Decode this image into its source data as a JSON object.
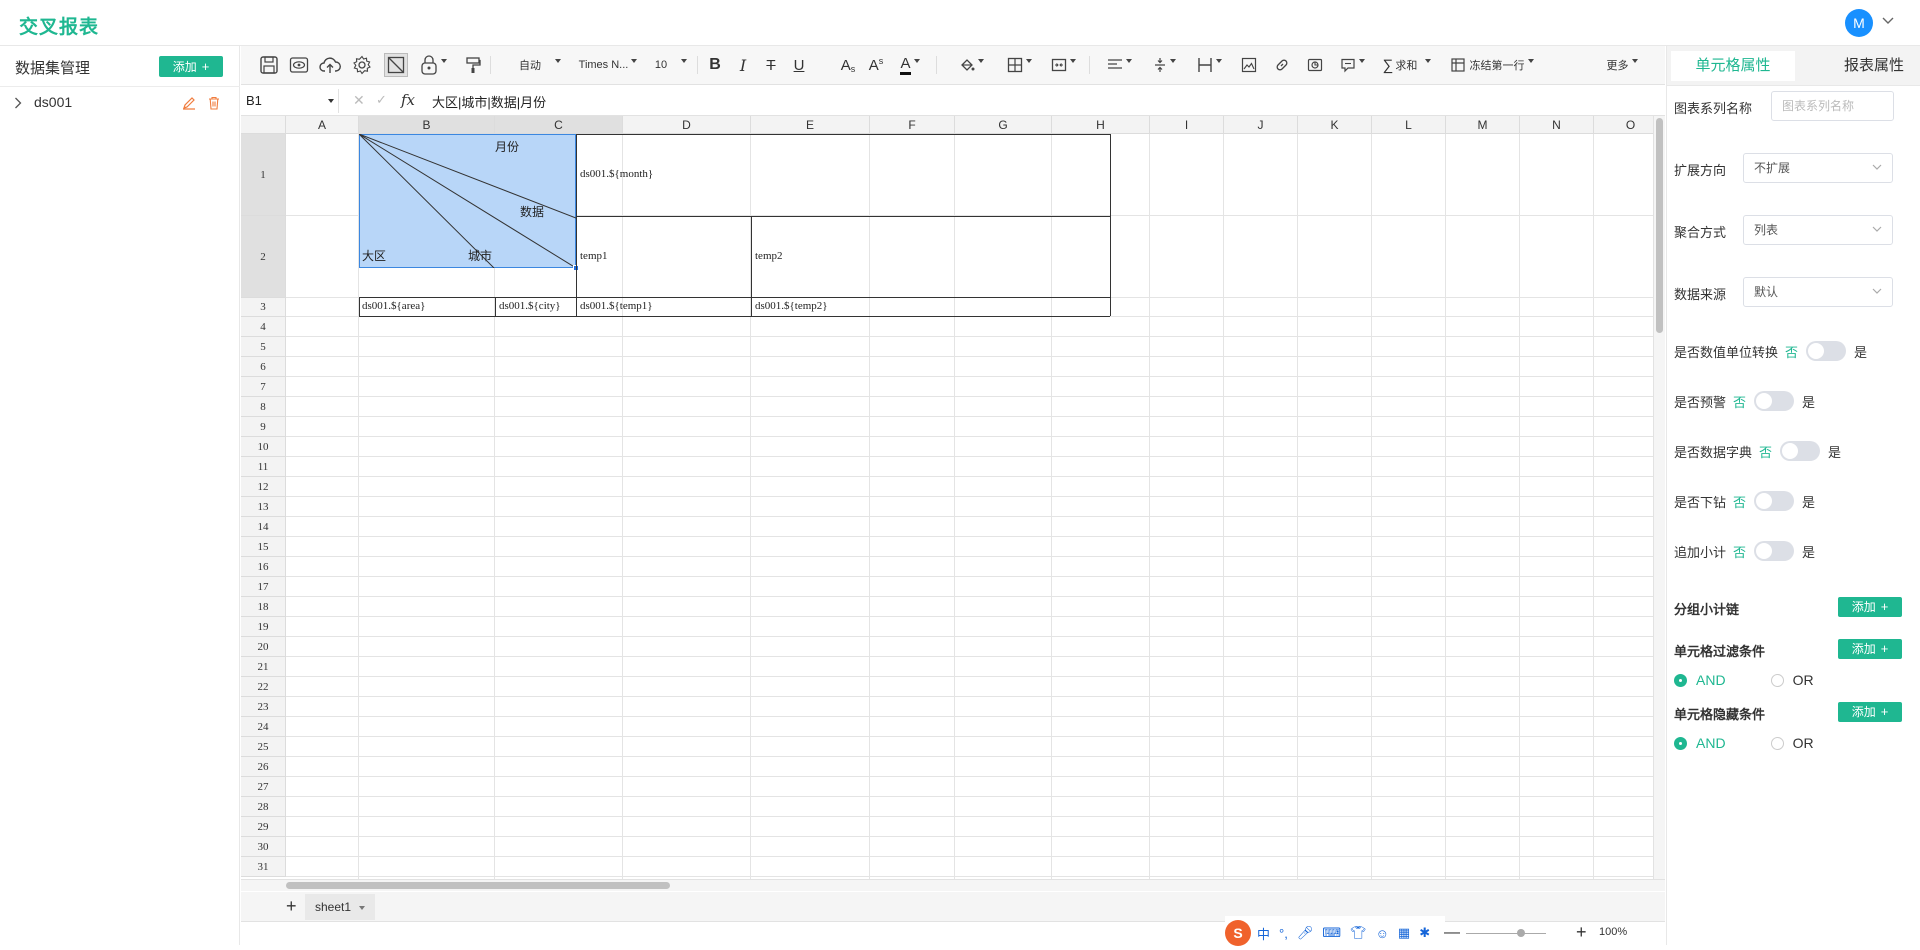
{
  "app": {
    "title": "交叉报表",
    "avatar_letter": "M"
  },
  "left_panel": {
    "title": "数据集管理",
    "add_label": "添加",
    "datasets": [
      {
        "name": "ds001"
      }
    ]
  },
  "toolbar": {
    "font_size_mode": "自动",
    "font_family": "Times N...",
    "font_size": "10",
    "sum_label": "求和",
    "freeze_label": "冻结第一行",
    "more_label": "更多"
  },
  "formula_bar": {
    "cell_ref": "B1",
    "fx": "fx",
    "formula": "大区|城市|数据|月份"
  },
  "grid": {
    "columns": [
      "A",
      "B",
      "C",
      "D",
      "E",
      "F",
      "G",
      "H",
      "I",
      "J",
      "K",
      "L",
      "M",
      "N",
      "O"
    ],
    "rows": [
      "1",
      "2",
      "3",
      "4",
      "5",
      "6",
      "7",
      "8",
      "9",
      "10",
      "11",
      "12",
      "13",
      "14",
      "15",
      "16",
      "17",
      "18",
      "19",
      "20",
      "21",
      "22",
      "23",
      "24",
      "25",
      "26",
      "27",
      "28",
      "29",
      "30",
      "31"
    ],
    "diagonal_labels": {
      "month": "月份",
      "data": "数据",
      "area": "大区",
      "city": "城市"
    },
    "cells": {
      "D1": "ds001.${month}",
      "D2": "temp1",
      "E2": "temp2",
      "B3": "ds001.${area}",
      "C3": "ds001.${city}",
      "D3": "ds001.${temp1}",
      "E3": "ds001.${temp2}"
    }
  },
  "sheet": {
    "name": "sheet1",
    "add": "+"
  },
  "zoom": {
    "value": "100%",
    "minus": "—",
    "plus": "+"
  },
  "ime": {
    "lang": "中",
    "punct": "°,"
  },
  "right_panel": {
    "tabs": [
      "单元格属性",
      "报表属性"
    ],
    "series_name_label": "图表系列名称",
    "series_name_placeholder": "图表系列名称",
    "expand_label": "扩展方向",
    "expand_value": "不扩展",
    "aggregate_label": "聚合方式",
    "aggregate_value": "列表",
    "source_label": "数据来源",
    "source_value": "默认",
    "toggles": [
      {
        "label": "是否数值单位转换",
        "no": "否",
        "yes": "是"
      },
      {
        "label": "是否预警",
        "no": "否",
        "yes": "是"
      },
      {
        "label": "是否数据字典",
        "no": "否",
        "yes": "是"
      },
      {
        "label": "是否下钻",
        "no": "否",
        "yes": "是"
      },
      {
        "label": "追加小计",
        "no": "否",
        "yes": "是"
      }
    ],
    "group_subtotal_label": "分组小计链",
    "filter_label": "单元格过滤条件",
    "hide_label": "单元格隐藏条件",
    "add_label": "添加",
    "and_label": "AND",
    "or_label": "OR"
  }
}
